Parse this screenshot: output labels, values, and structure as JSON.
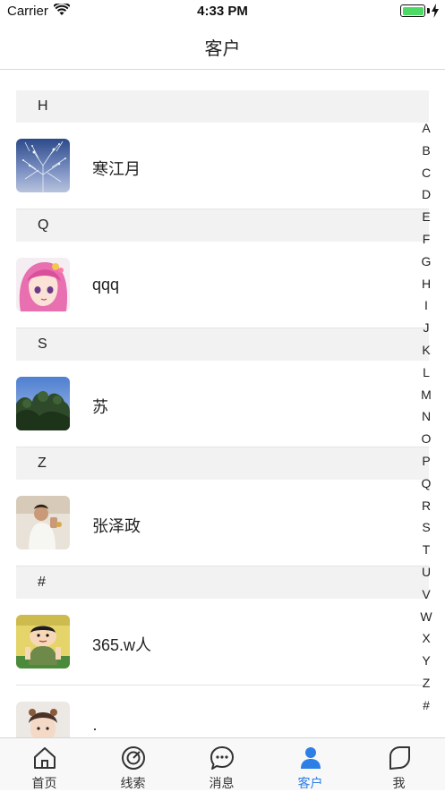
{
  "status_bar": {
    "carrier": "Carrier",
    "time": "4:33 PM"
  },
  "nav": {
    "title": "客户"
  },
  "sections": [
    {
      "header": "H",
      "rows": [
        {
          "name": "寒江月",
          "avatar": "tree-branches"
        }
      ]
    },
    {
      "header": "Q",
      "rows": [
        {
          "name": "qqq",
          "avatar": "pink-hair-girl"
        }
      ]
    },
    {
      "header": "S",
      "rows": [
        {
          "name": "苏",
          "avatar": "tree-sky"
        }
      ]
    },
    {
      "header": "Z",
      "rows": [
        {
          "name": "张泽政",
          "avatar": "man-photo"
        }
      ]
    },
    {
      "header": "#",
      "rows": [
        {
          "name": "365.w人",
          "avatar": "cartoon-boy"
        },
        {
          "name": "·",
          "avatar": "child-photo"
        }
      ]
    }
  ],
  "index_letters": [
    "A",
    "B",
    "C",
    "D",
    "E",
    "F",
    "G",
    "H",
    "I",
    "J",
    "K",
    "L",
    "M",
    "N",
    "O",
    "P",
    "Q",
    "R",
    "S",
    "T",
    "U",
    "V",
    "W",
    "X",
    "Y",
    "Z",
    "#"
  ],
  "tabs": [
    {
      "label": "首页",
      "icon": "home-icon",
      "active": false
    },
    {
      "label": "线索",
      "icon": "target-icon",
      "active": false
    },
    {
      "label": "消息",
      "icon": "chat-bubble-icon",
      "active": false
    },
    {
      "label": "客户",
      "icon": "person-icon",
      "active": true
    },
    {
      "label": "我",
      "icon": "leaf-icon",
      "active": false
    }
  ],
  "colors": {
    "accent": "#2d7fe6",
    "section_bg": "#f2f2f2",
    "battery": "#4cd964"
  }
}
